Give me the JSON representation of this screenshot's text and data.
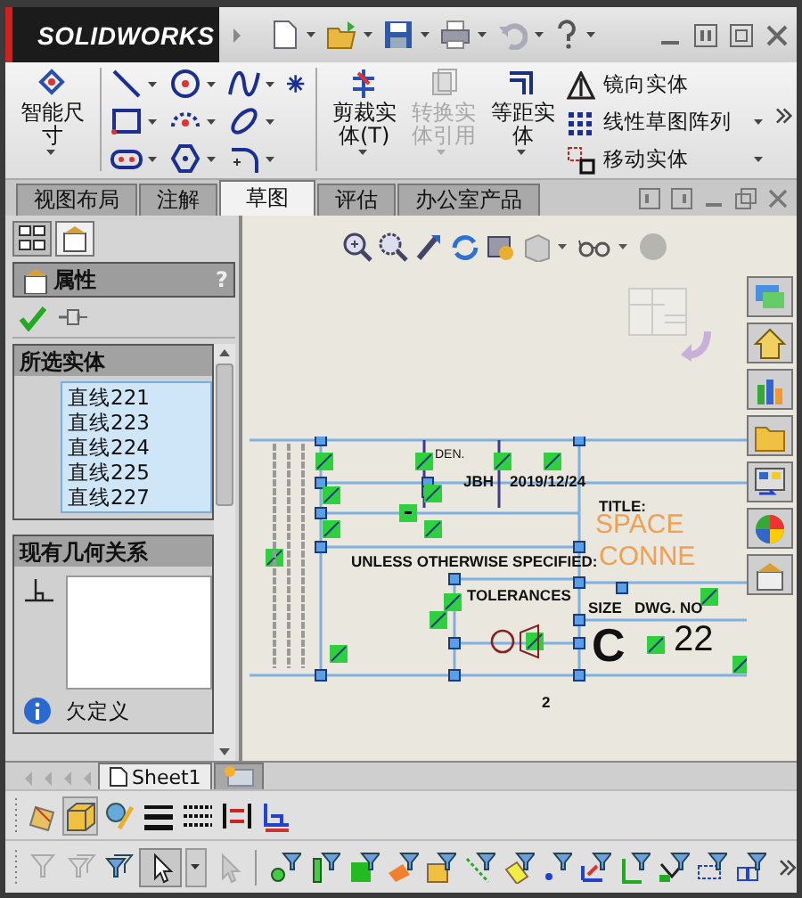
{
  "app": {
    "logo": "SOLIDWORKS"
  },
  "ribbon": {
    "large_tools": [
      {
        "label": "智能尺寸",
        "disabled": false
      },
      {
        "label": "剪裁实体(T)",
        "disabled": false
      },
      {
        "label": "转换实体引用",
        "disabled": true
      },
      {
        "label": "等距实体",
        "disabled": false
      }
    ],
    "small_tools": [
      {
        "label": "镜向实体"
      },
      {
        "label": "线性草图阵列"
      },
      {
        "label": "移动实体"
      }
    ]
  },
  "tabs": [
    {
      "label": "视图布局",
      "selected": false
    },
    {
      "label": "注解",
      "selected": false
    },
    {
      "label": "草图",
      "selected": true
    },
    {
      "label": "评估",
      "selected": false
    },
    {
      "label": "办公室产品",
      "selected": false
    }
  ],
  "property_manager": {
    "tabs": [
      {
        "selected": false
      },
      {
        "selected": true
      }
    ],
    "title": "属性",
    "help": "?",
    "selected_entities": {
      "heading": "所选实体",
      "items": [
        "直线221",
        "直线223",
        "直线224",
        "直线225",
        "直线227"
      ]
    },
    "relations": {
      "heading": "现有几何关系"
    },
    "status": "欠定义"
  },
  "drawing": {
    "labels": [
      {
        "text": "DEN."
      },
      {
        "text": "JBH"
      },
      {
        "text": "2019/12/24"
      },
      {
        "text": "UNLESS OTHERWISE SPECIFIED:"
      },
      {
        "text": "TOLERANCES"
      },
      {
        "text": "TITLE:"
      },
      {
        "text": "SPACE"
      },
      {
        "text": "CONNE"
      },
      {
        "text": "SIZE"
      },
      {
        "text": "DWG. NO"
      },
      {
        "text": "C"
      },
      {
        "text": "22"
      },
      {
        "text": "2"
      }
    ]
  },
  "sheet_tabs": [
    {
      "label": "Sheet1",
      "selected": true
    }
  ]
}
